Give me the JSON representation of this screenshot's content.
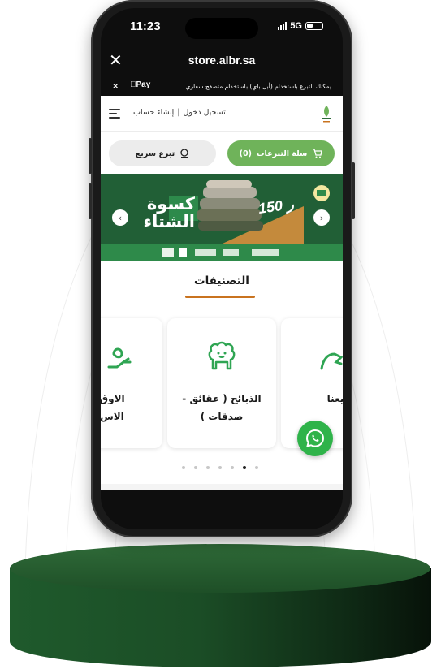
{
  "status_bar": {
    "time": "11:23",
    "network": "5G"
  },
  "browser": {
    "url": "store.albr.sa",
    "close_icon": "close-icon"
  },
  "apple_pay_bar": {
    "close": "×",
    "logo": "Pay",
    "message": "يمكنك التبرع باستخدام (أبل باي) باستخدام متصفح سفاري"
  },
  "header": {
    "login": "تسجيل دخول",
    "separator": "|",
    "register": "إنشاء حساب"
  },
  "actions": {
    "cart_label": "سلة التبرعات",
    "cart_count": "(0)",
    "quick_label": "تبرع سريع"
  },
  "banner": {
    "title_line1": "كسوة",
    "title_line2": "الشتاء",
    "price": "150"
  },
  "categories_section": {
    "title": "التصنيفات",
    "items": [
      {
        "label": "يعنا"
      },
      {
        "label": "الذبائح ( عقائق - صدقات )"
      },
      {
        "label": "الاوق الاس"
      }
    ]
  },
  "carousel": {
    "dot_count": 7,
    "active_dot": 5
  },
  "colors": {
    "brand_green": "#6fb35a",
    "dark_green": "#1d5c33",
    "accent_orange": "#c9731f",
    "whatsapp": "#2fb34a"
  }
}
